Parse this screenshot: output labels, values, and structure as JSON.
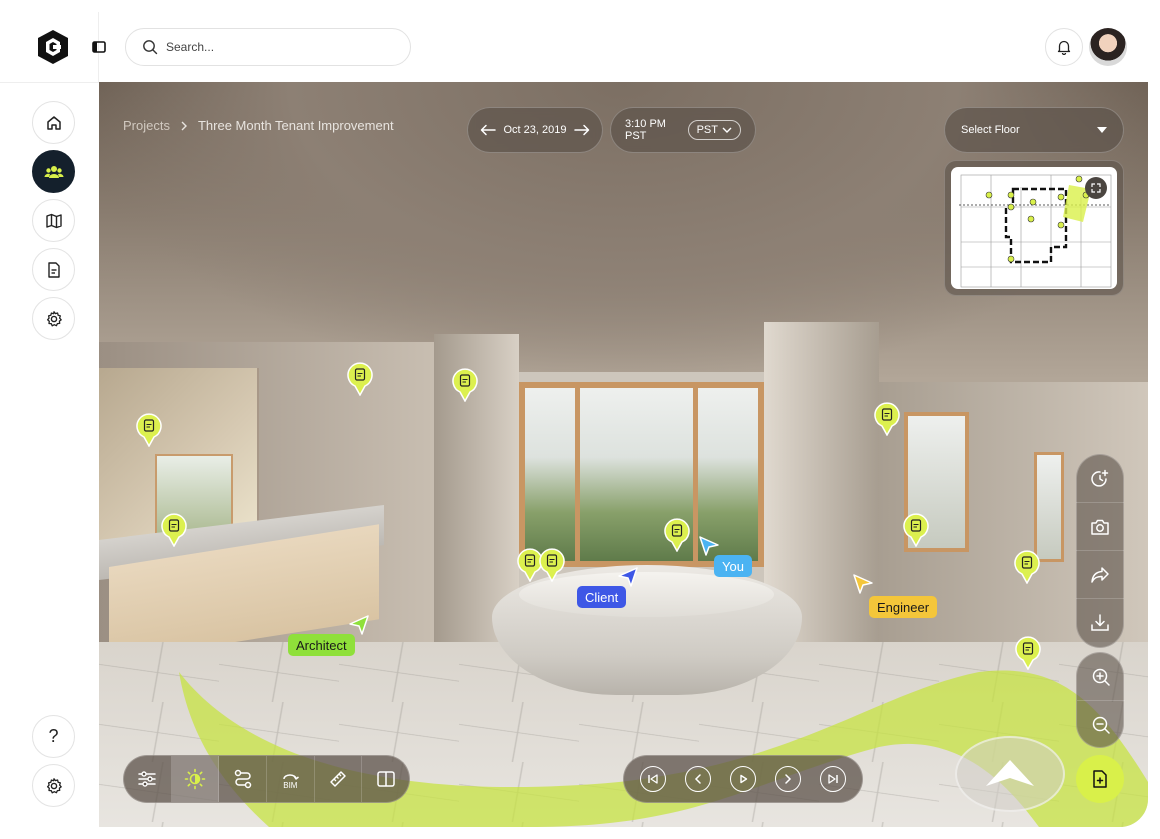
{
  "search": {
    "placeholder": "Search..."
  },
  "breadcrumb": {
    "root": "Projects",
    "current": "Three Month Tenant Improvement"
  },
  "date": {
    "value": "Oct 23, 2019"
  },
  "time": {
    "value": "3:10 PM PST",
    "timezone": "PST"
  },
  "floor_select": {
    "label": "Select Floor"
  },
  "cursors": {
    "you": "You",
    "client": "Client",
    "engineer": "Engineer",
    "architect": "Architect"
  },
  "bottom_tools": {
    "bim_label": "BIM"
  },
  "colors": {
    "accent": "#d9f04a",
    "pin": "#dcf04f",
    "you": "#4bb3f2",
    "client": "#3e57e6",
    "engineer": "#f4c63a",
    "architect": "#8fe03a",
    "sidebar_active": "#14202c"
  },
  "icons": [
    "logo-icon",
    "sidebar-toggle-icon",
    "search-icon",
    "bell-icon",
    "home-icon",
    "team-icon",
    "map-icon",
    "document-icon",
    "settings-icon",
    "help-icon",
    "history-add-icon",
    "camera-icon",
    "share-icon",
    "download-icon",
    "zoom-in-icon",
    "zoom-out-icon",
    "filter-icon",
    "brightness-icon",
    "route-icon",
    "bim-icon",
    "measure-icon",
    "split-view-icon",
    "skip-back-icon",
    "prev-icon",
    "play-icon",
    "next-icon",
    "skip-forward-icon",
    "forward-arrow-icon",
    "add-document-icon"
  ]
}
